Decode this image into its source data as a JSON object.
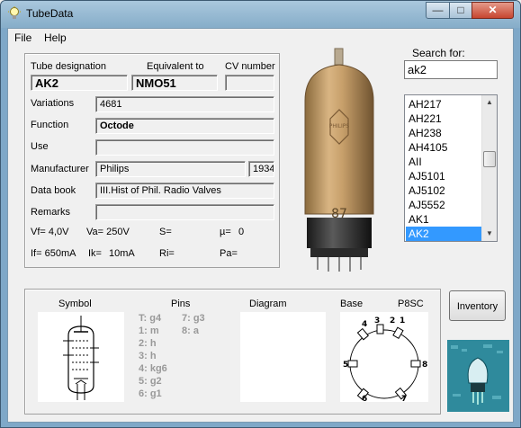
{
  "window": {
    "title": "TubeData"
  },
  "menu": {
    "file": "File",
    "help": "Help"
  },
  "header": {
    "designation_label": "Tube designation",
    "equivalent_label": "Equivalent to",
    "cv_label": "CV number",
    "designation": "AK2",
    "equivalent": "NMO51",
    "cv": ""
  },
  "info": {
    "variations_label": "Variations",
    "variations": "4681",
    "function_label": "Function",
    "function": "Octode",
    "use_label": "Use",
    "use": "",
    "manufacturer_label": "Manufacturer",
    "manufacturer": "Philips",
    "year": "1934",
    "databook_label": "Data book",
    "databook": "III.Hist of Phil. Radio Valves",
    "remarks_label": "Remarks",
    "remarks": ""
  },
  "params": {
    "vf": "Vf= 4,0V",
    "va": "Va= 250V",
    "s": "S=",
    "mu": "µ=",
    "mu_val": "0",
    "if": "If= 650mA",
    "ik": "Ik=",
    "ik_val": "10mA",
    "ri": "Ri=",
    "pa": "Pa="
  },
  "search": {
    "label": "Search for:",
    "value": "ak2",
    "results": [
      "AH217",
      "AH221",
      "AH238",
      "AH4105",
      "AII",
      "AJ5101",
      "AJ5102",
      "AJ5552",
      "AK1",
      "AK2"
    ],
    "selected": "AK2"
  },
  "bottom": {
    "symbol_label": "Symbol",
    "pins_label": "Pins",
    "diagram_label": "Diagram",
    "base_label": "Base",
    "base_type": "P8SC",
    "pins_left": [
      "T: g4",
      "1: m",
      "2: h",
      "3: h",
      "4: kg6",
      "5: g2",
      "6: g1"
    ],
    "pins_right": [
      "7: g3",
      "8: a"
    ],
    "base_numbers": [
      "1",
      "2",
      "3",
      "4",
      "5",
      "6",
      "7",
      "8"
    ],
    "inventory_button": "Inventory"
  },
  "photo": {
    "label": "87"
  },
  "icons": {
    "app": "lightbulb-icon",
    "minimize": "minimize-icon",
    "maximize": "maximize-icon",
    "close": "close-icon"
  }
}
